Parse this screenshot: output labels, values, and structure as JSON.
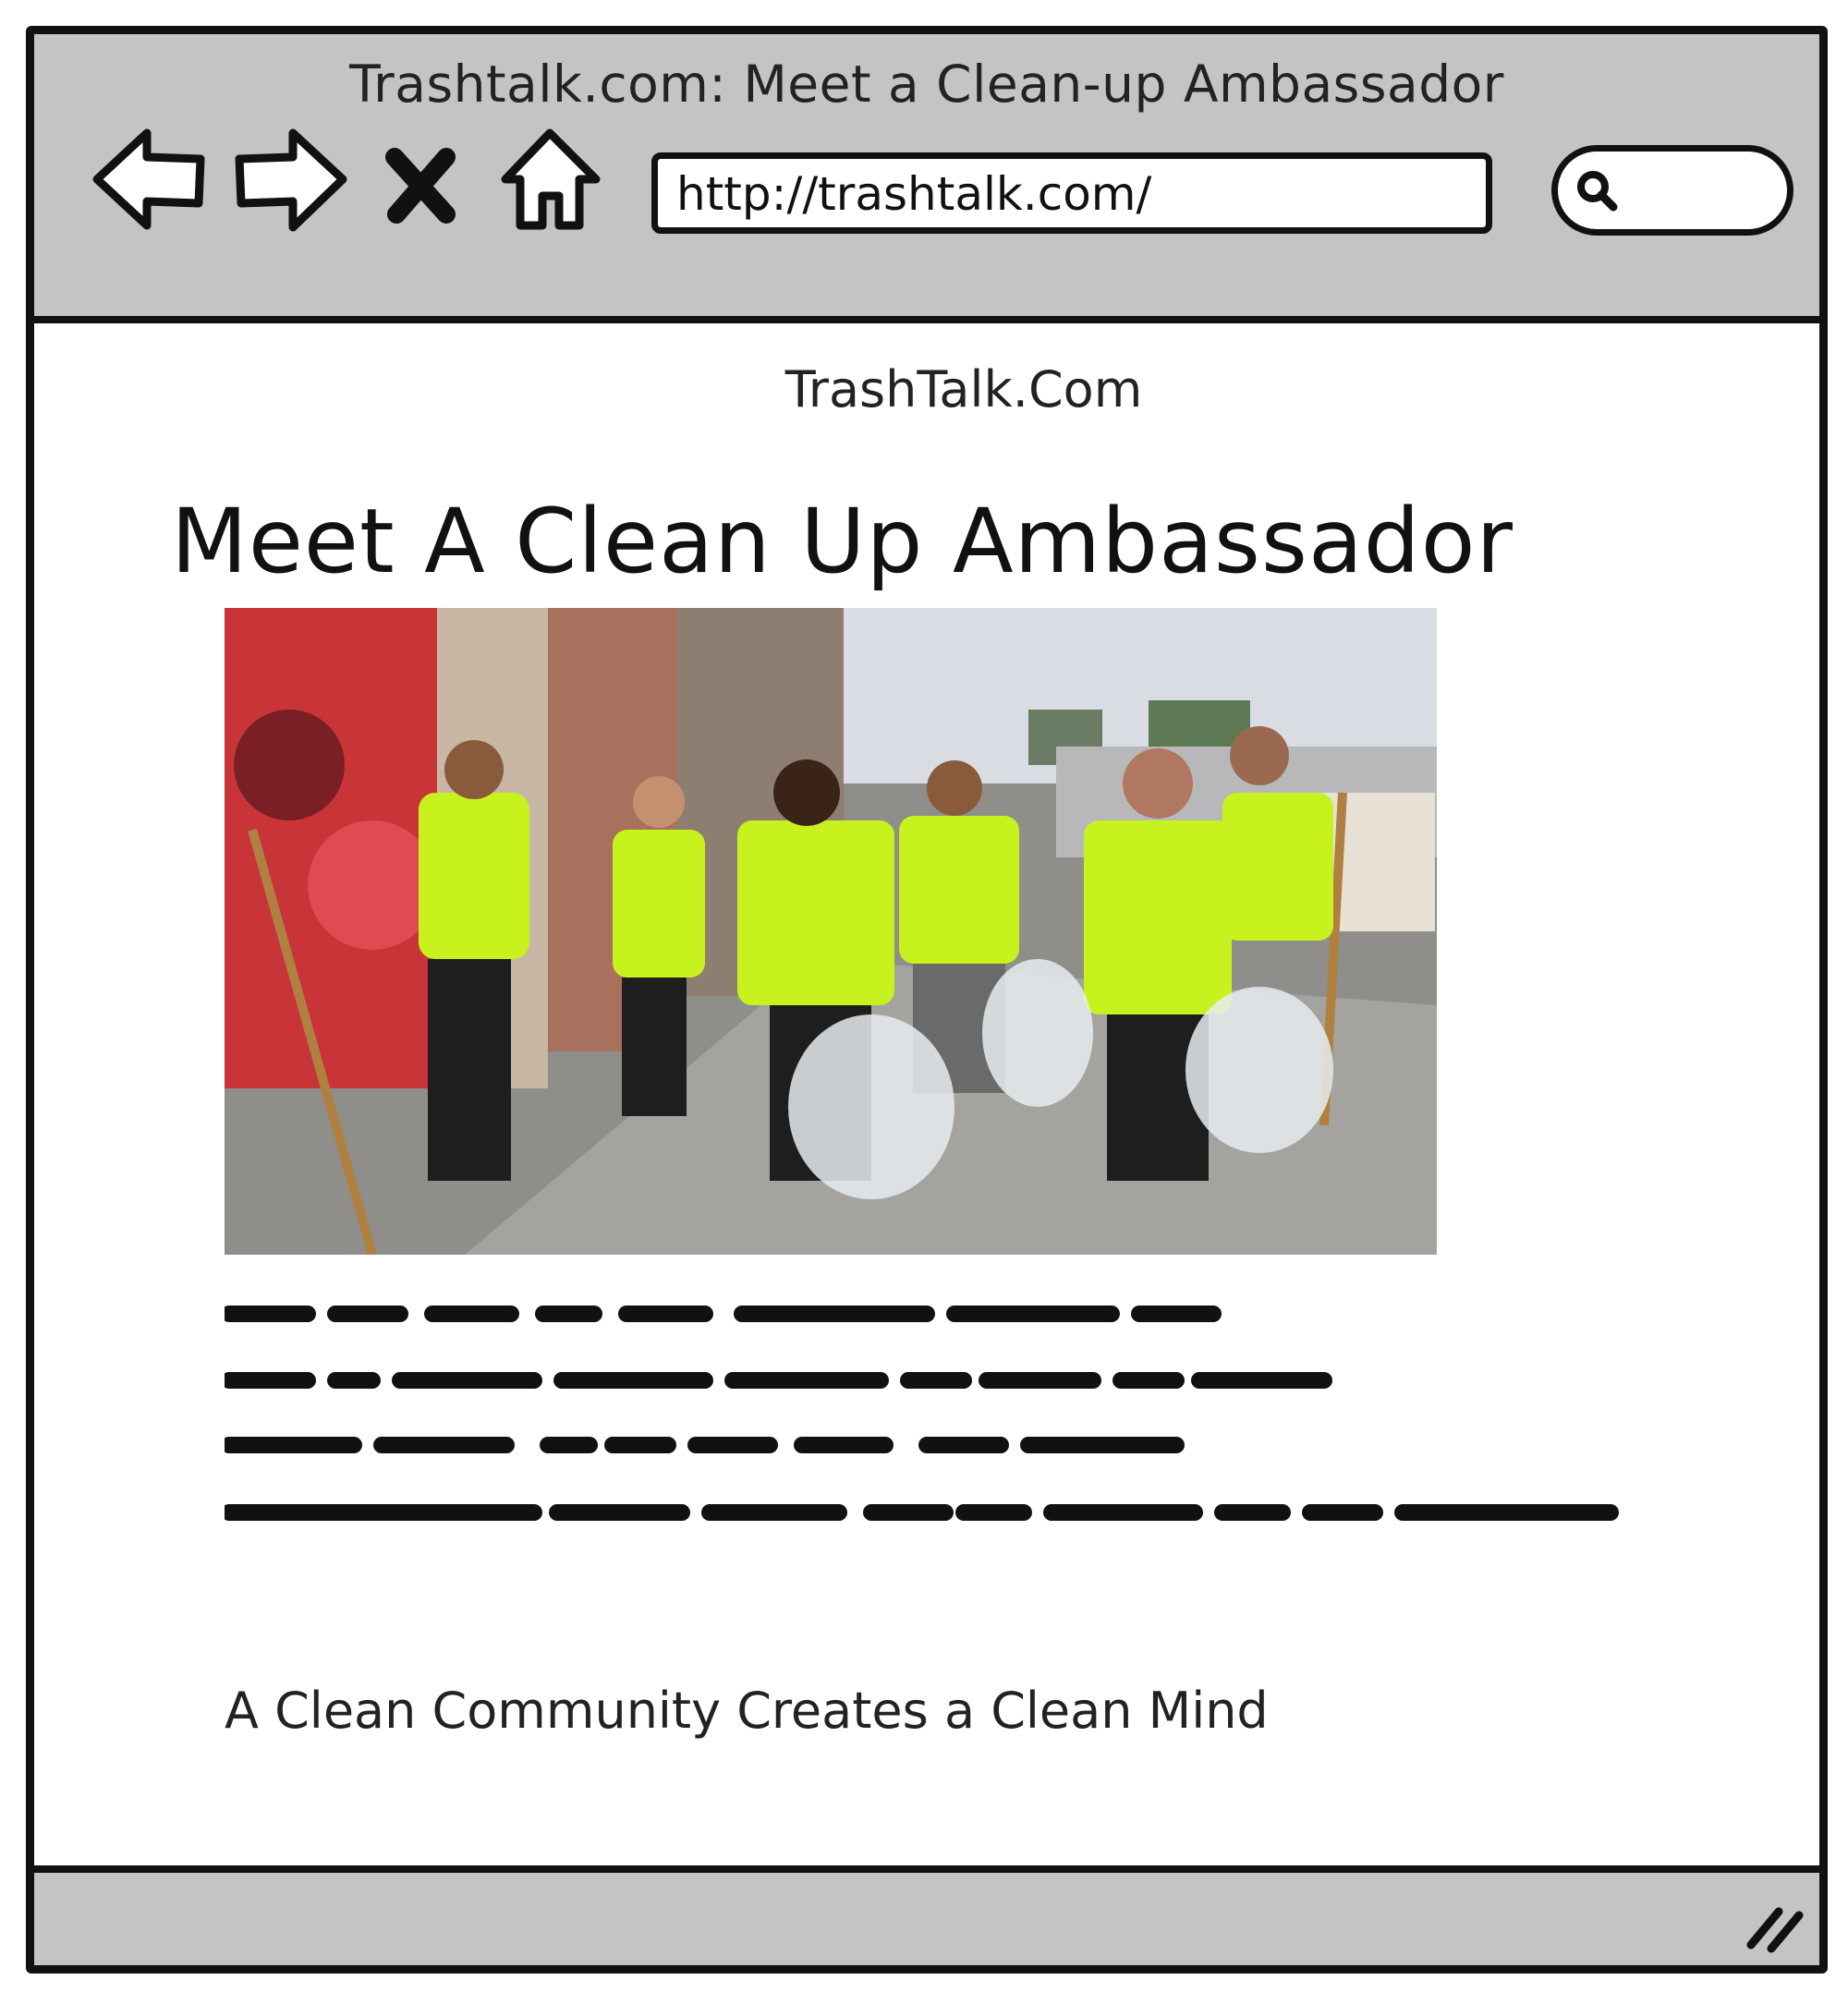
{
  "window": {
    "title": "Trashtalk.com: Meet a Clean-up Ambassador"
  },
  "toolbar": {
    "back_icon": "back-arrow-icon",
    "forward_icon": "forward-arrow-icon",
    "stop_icon": "close-x-icon",
    "home_icon": "home-icon",
    "url": "http://trashtalk.com/",
    "search_icon": "search-icon"
  },
  "page": {
    "site_name": "TrashTalk.Com",
    "title": "Meet A Clean Up Ambassador",
    "photo_description_icon": "group-photo-volunteers",
    "tagline": "A Clean Community Creates a Clean Mind"
  },
  "colors": {
    "chrome": "#c4c4c4",
    "border": "#111111",
    "vest": "#c8f21e"
  }
}
